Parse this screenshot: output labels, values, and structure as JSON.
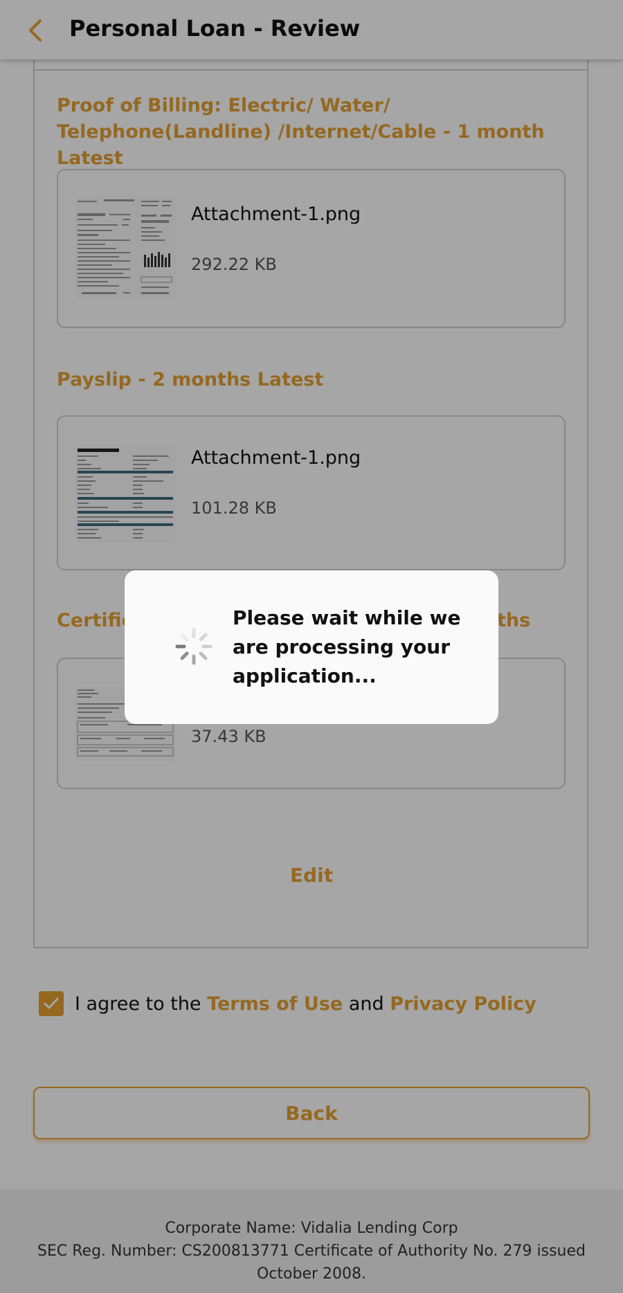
{
  "header": {
    "title": "Personal Loan - Review"
  },
  "sections": [
    {
      "title": "Proof of Billing: Electric/ Water/ Telephone(Landline) /Internet/Cable - 1 month Latest",
      "file_name": "Attachment-1.png",
      "file_size": "292.22 KB"
    },
    {
      "title": "Payslip - 2 months Latest",
      "file_name": "Attachment-1.png",
      "file_size": "101.28 KB"
    },
    {
      "title_visible_start": "Certific",
      "title_visible_end": "ths",
      "file_size": "37.43 KB"
    }
  ],
  "edit_label": "Edit",
  "agreement": {
    "prefix": "I agree to the",
    "terms_link": "Terms of Use",
    "and": "and",
    "privacy_link": "Privacy Policy"
  },
  "back_label": "Back",
  "footer": {
    "line1": "Corporate Name: Vidalia Lending Corp",
    "line2": "SEC Reg. Number: CS200813771 Certificate of Authority No. 279 issued October 2008."
  },
  "modal": {
    "message": "Please wait while we are processing your application..."
  },
  "colors": {
    "accent": "#e5a034",
    "overlay": "rgba(0,0,0,0.35)"
  }
}
